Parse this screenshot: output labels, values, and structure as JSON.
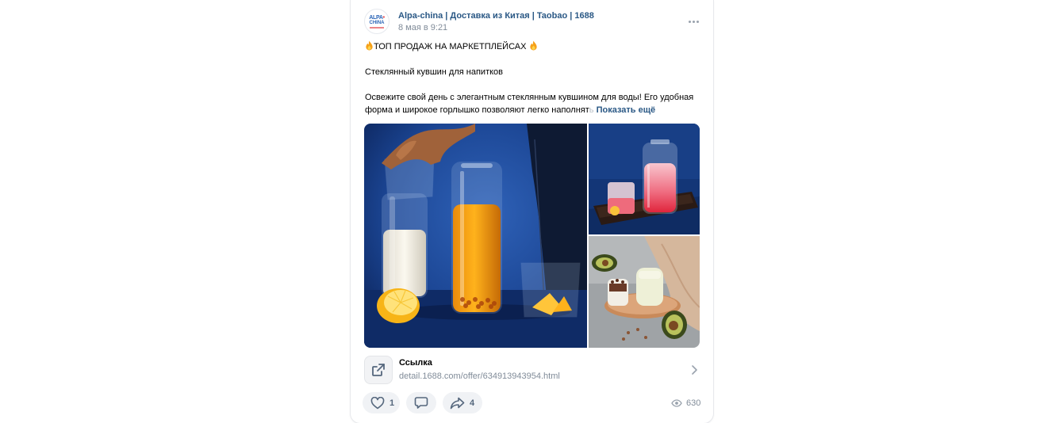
{
  "post": {
    "author": "Alpa-china | Доставка из Китая | Taobao | 1688",
    "date": "8 мая в 9:21",
    "avatar": {
      "line1": "ALPA",
      "line2": "CHINA"
    },
    "headline": "ТОП ПРОДАЖ НА МАРКЕТПЛЕЙСАХ",
    "product_title": "Стеклянный кувшин для напитков",
    "description_line1": "Освежите свой день с элегантным стеклянным кувшином для воды! Его удобная",
    "description_line2": "форма и широкое горлышко позволяют легко наполнят",
    "ellipsis": "ь",
    "show_more": "Показать ещё"
  },
  "attachment": {
    "title": "Ссылка",
    "url": "detail.1688.com/offer/634913943954.html"
  },
  "actions": {
    "likes": "1",
    "shares": "4",
    "views": "630"
  },
  "colors": {
    "link_blue": "#2a5885",
    "muted": "#818c99",
    "pill_bg": "#f0f2f5",
    "icon": "#55677d"
  },
  "icons": [
    "fire-icon",
    "more-icon",
    "external-link-icon",
    "chevron-right-icon",
    "heart-icon",
    "comment-icon",
    "share-icon",
    "eye-icon"
  ]
}
